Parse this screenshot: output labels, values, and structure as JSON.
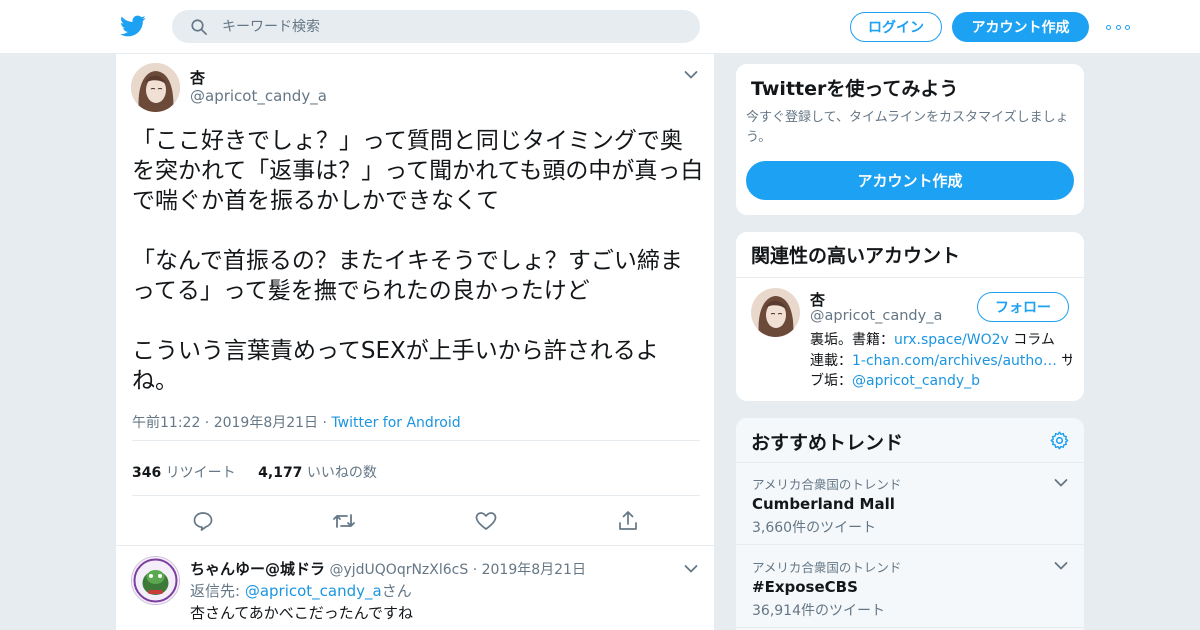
{
  "header": {
    "search_placeholder": "キーワード検索",
    "login_label": "ログイン",
    "signup_label": "アカウント作成"
  },
  "tweet": {
    "name": "杏",
    "handle": "@apricot_candy_a",
    "lines": [
      "「ここ好きでしょ？」って質問と同じタイミングで奥",
      "を突かれて「返事は？」って聞かれても頭の中が真っ白",
      "で喘ぐか首を振るかしかできなくて",
      "",
      "「なんで首振るの？またイキそうでしょ？すごい締ま",
      "ってる」って髪を撫でられたの良かったけど",
      "",
      "こういう言葉責めってSEXが上手いから許されるよ",
      "ね。"
    ],
    "time": "午前11:22 · 2019年8月21日",
    "dot": "·",
    "client": "Twitter for Android",
    "retweets_count": "346",
    "retweets_label": "リツイート",
    "likes_count": "4,177",
    "likes_label": "いいねの数"
  },
  "reply": {
    "name": "ちゃんゆー@城ドラ",
    "handle": "@yjdUQOqrNzXl6cS",
    "date": "· 2019年8月21日",
    "reply_to_prefix": "返信先: ",
    "reply_to_handle": "@apricot_candy_a",
    "reply_to_suffix": "さん",
    "text": "杏さんてあかべこだったんですね"
  },
  "signup_card": {
    "title": "Twitterを使ってみよう",
    "subtitle_line1": "今すぐ登録して、タイムラインをカスタマイズしましょ",
    "subtitle_line2": "う。",
    "button": "アカウント作成"
  },
  "related": {
    "title": "関連性の高いアカウント",
    "name": "杏",
    "handle": "@apricot_candy_a",
    "follow_label": "フォロー",
    "bio_1_text": "裏垢。書籍：",
    "bio_1_link": "urx.space/WO2v",
    "bio_1_tail": " コラム",
    "bio_2_text": "連載：",
    "bio_2_link": "1-chan.com/archives/autho…",
    "bio_2_tail": " サ",
    "bio_3_text": "ブ垢：",
    "bio_3_link": "@apricot_candy_b"
  },
  "trends": {
    "title": "おすすめトレンド",
    "items": [
      {
        "context": "アメリカ合衆国のトレンド",
        "name": "Cumberland Mall",
        "count": "3,660件のツイート"
      },
      {
        "context": "アメリカ合衆国のトレンド",
        "name": "#ExposeCBS",
        "count": "36,914件のツイート"
      }
    ]
  },
  "colors": {
    "brand": "#1da1f2",
    "link": "#1b95e0",
    "text": "#14171a",
    "secondary": "#657786",
    "background": "#e6ecf0"
  },
  "icons": [
    "twitter-logo-icon",
    "search-icon",
    "more-icon",
    "chevron-down-icon",
    "reply-icon",
    "retweet-icon",
    "like-icon",
    "share-icon",
    "settings-gear-icon"
  ]
}
